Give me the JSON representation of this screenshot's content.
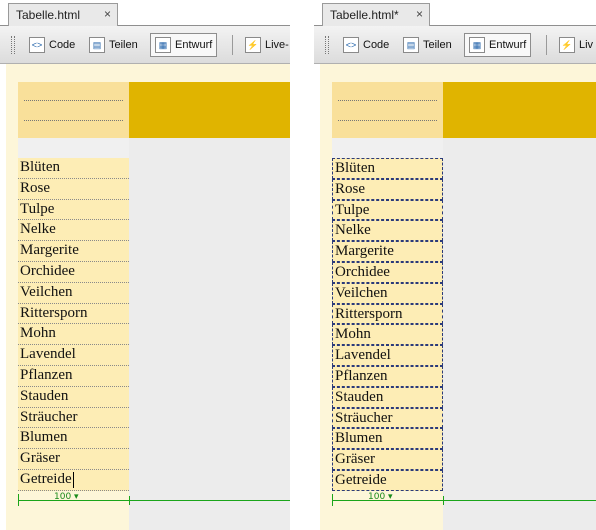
{
  "panels": [
    {
      "tab": {
        "title": "Tabelle.html",
        "close": "×"
      },
      "toolbar": {
        "code": "Code",
        "split": "Teilen",
        "design": "Entwurf",
        "live": "Live-"
      },
      "items": [
        "Blüten",
        "Rose",
        "Tulpe",
        "Nelke",
        "Margerite",
        "Orchidee",
        "Veilchen",
        "Rittersporn",
        "Mohn",
        "Lavendel",
        "Pflanzen",
        "Stauden",
        "Sträucher",
        "Blumen",
        "Gräser",
        "Getreide"
      ],
      "column_width_label": "100 ▾"
    },
    {
      "tab": {
        "title": "Tabelle.html*",
        "close": "×"
      },
      "toolbar": {
        "code": "Code",
        "split": "Teilen",
        "design": "Entwurf",
        "live": "Liv"
      },
      "items": [
        "Blüten",
        "Rose",
        "Tulpe",
        "Nelke",
        "Margerite",
        "Orchidee",
        "Veilchen",
        "Rittersporn",
        "Mohn",
        "Lavendel",
        "Pflanzen",
        "Stauden",
        "Sträucher",
        "Blumen",
        "Gräser",
        "Getreide"
      ],
      "column_width_label": "100 ▾"
    }
  ],
  "colors": {
    "header_left": "#f9e09a",
    "header_right": "#e0b400",
    "cell_background": "#fdedb5",
    "canvas": "#fdf6d9",
    "dimension_guide": "#1aa51a"
  }
}
